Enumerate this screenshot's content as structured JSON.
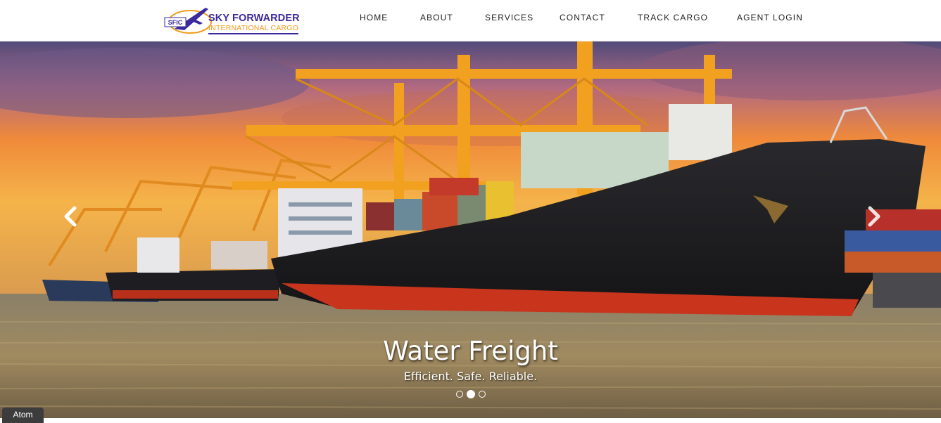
{
  "logo": {
    "mark_text": "SFIC",
    "name": "SKY FORWARDER",
    "tagline": "INTERNATIONAL CARGO"
  },
  "nav": {
    "items": [
      "HOME",
      "ABOUT",
      "SERVICES",
      "CONTACT",
      "TRACK CARGO",
      "AGENT LOGIN"
    ]
  },
  "hero": {
    "title": "Water Freight",
    "subtitle": "Efficient. Safe. Reliable.",
    "slide_count": 3,
    "active_slide": 2
  },
  "badge": {
    "label": "Atom"
  },
  "colors": {
    "brand_purple": "#3b2a9e",
    "brand_orange": "#f39a1c",
    "crane_orange": "#f2a020",
    "hull_black": "#1c1c1e",
    "hull_red": "#c8341c"
  },
  "icons": {
    "prev": "chevron-left-icon",
    "next": "chevron-right-icon"
  }
}
